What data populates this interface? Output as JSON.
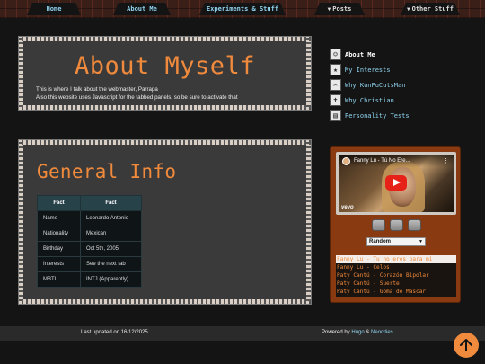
{
  "nav": {
    "items": [
      {
        "label": "Home",
        "dropdown": false
      },
      {
        "label": "About Me",
        "dropdown": false
      },
      {
        "label": "Experiments & Stuff",
        "dropdown": false
      },
      {
        "label": "Posts",
        "dropdown": true
      },
      {
        "label": "Other Stuff",
        "dropdown": true
      }
    ]
  },
  "about": {
    "title": "About Myself",
    "line1": "This is where I talk about the webmaster, Parrapa",
    "line2": "Also this website uses Javascript for the tabbed panels, so be sure to activate that"
  },
  "general": {
    "title": "General Info",
    "table": {
      "headers": [
        "Fact",
        "Fact"
      ],
      "rows": [
        [
          "Name",
          "Leonardo Antonio"
        ],
        [
          "Nationality",
          "Mexican"
        ],
        [
          "Birthday",
          "Oct 5th, 2005"
        ],
        [
          "Interests",
          "See the next tab"
        ],
        [
          "MBTI",
          "INTJ (Apparently)"
        ]
      ]
    }
  },
  "sidebar": {
    "items": [
      {
        "label": "About Me",
        "icon": "user-icon",
        "active": true
      },
      {
        "label": "My Interests",
        "icon": "star-icon",
        "active": false
      },
      {
        "label": "Why KunFuCutsMan",
        "icon": "scissors-icon",
        "active": false
      },
      {
        "label": "Why Christian",
        "icon": "cross-icon",
        "active": false
      },
      {
        "label": "Personality Tests",
        "icon": "book-icon",
        "active": false
      }
    ]
  },
  "player": {
    "video_title": "Fanny Lu - Tú No Ere...",
    "video_brand": "vevo",
    "mode": "Random",
    "playlist": [
      "Fanny Lu - Tu no eres para mi",
      "Fanny Lu - Celos",
      "Paty Cantú - Corazón Bipolar",
      "Paty Cantú - Suerte",
      "Paty Cantú - Goma de Mascar"
    ]
  },
  "footer": {
    "updated": "Last updated on 16/12/2025",
    "powered_prefix": "Powered by ",
    "hugo": "Hugo",
    "amp": " & ",
    "neocities": "Neocities"
  },
  "colors": {
    "accent": "#f08a3c",
    "link": "#8fd3ef",
    "background": "#141414",
    "panel": "#3a3a3a"
  }
}
